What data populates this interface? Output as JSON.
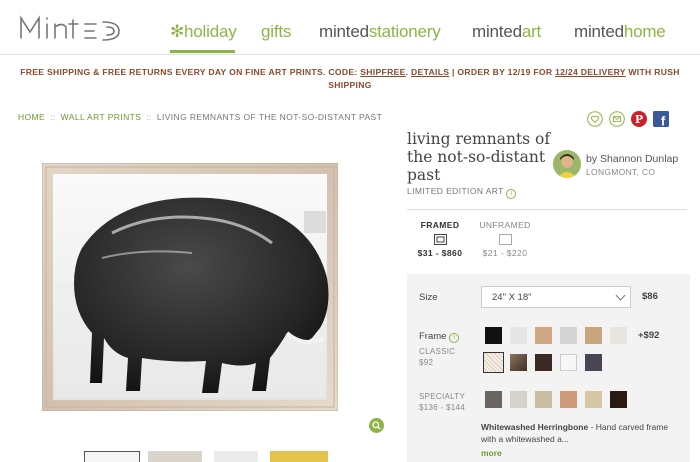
{
  "logo": {
    "text": "MINTED"
  },
  "nav": {
    "holiday": "holiday",
    "gifts": "gifts",
    "stationery": [
      "minted",
      "stationery"
    ],
    "art": [
      "minted",
      "art"
    ],
    "home": [
      "minted",
      "home"
    ]
  },
  "banner": {
    "part1": "FREE SHIPPING & FREE RETURNS EVERY DAY ON FINE ART PRINTS. CODE: ",
    "code": "SHIPFREE",
    "details": "DETAILS",
    "part2": " | ORDER BY 12/19 FOR ",
    "delivery": "12/24 DELIVERY",
    "part3": " WITH RUSH",
    "line2": "SHIPPING"
  },
  "breadcrumb": {
    "home": "HOME",
    "wall": "WALL ART PRINTS",
    "current": "LIVING REMNANTS OF THE NOT-SO-DISTANT PAST",
    "sep": "::"
  },
  "product": {
    "title": "living remnants of the not-so-distant past",
    "edition": "LIMITED EDITION ART"
  },
  "artist": {
    "name": "by Shannon Dunlap",
    "location": "LONGMONT, CO"
  },
  "tabs": {
    "framed_label": "FRAMED",
    "framed_price": "$31 - $860",
    "unframed_label": "UNFRAMED",
    "unframed_price": "$21 - $220"
  },
  "options": {
    "size_label": "Size",
    "size_value": "24\" X 18\"",
    "size_price": "$86",
    "frame_label": "Frame",
    "classic_label": "CLASSIC",
    "classic_price": "$92",
    "frame_price": "+$92",
    "specialty_label": "SPECIALTY",
    "specialty_price": "$136 - $144",
    "desc_title": "Whitewashed Herringbone",
    "desc_text": " - Hand carved frame with a whitewashed a...",
    "more": "more"
  },
  "colors": {
    "accent": "#8db545",
    "banner": "#8a4a2a",
    "pinterest": "#cb2027",
    "facebook": "#3b5998"
  },
  "swatches": {
    "classic_row1": [
      "#111111",
      "#e6e6e6",
      "#cfa882",
      "#d5d5d5",
      "#c9a57c",
      "#e9e4dc"
    ],
    "classic_row2": [
      "#f2ebe0",
      "#6b5a47",
      "#3a2a24",
      "#f7f7f7",
      "#4a4455"
    ],
    "specialty": [
      "#6a6560",
      "#d6d3cc",
      "#c9bda0",
      "#d09a7a",
      "#d8c7a5",
      "#2a1a12"
    ]
  }
}
